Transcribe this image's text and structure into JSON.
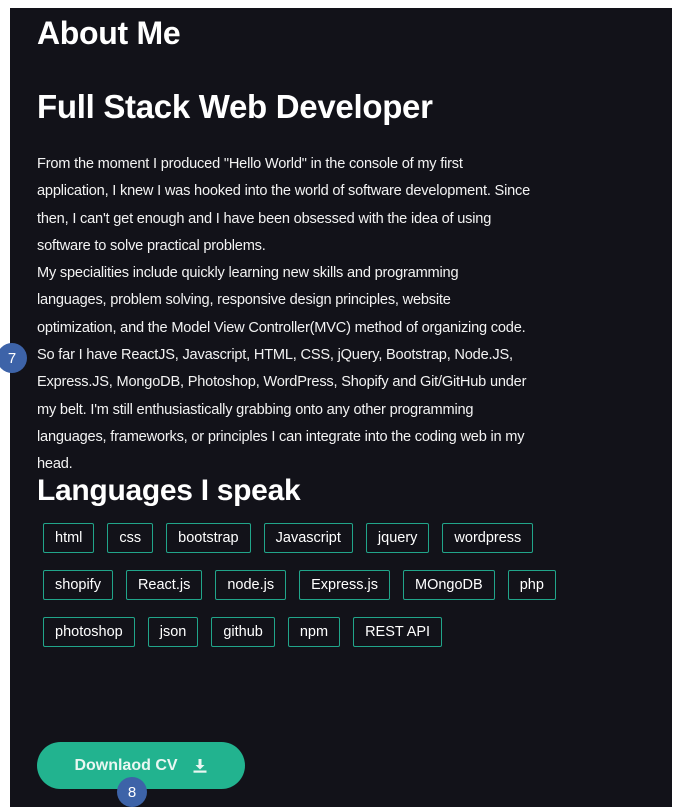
{
  "about": {
    "heading": "About Me"
  },
  "profile": {
    "role": "Full Stack Web Developer",
    "bio_lines": [
      "From the moment I produced \"Hello World\" in the console of my first",
      "application, I knew I was hooked into the world of software development. Since",
      "then, I can't get enough and I have been obsessed with the idea of using",
      "software to solve practical problems.",
      "My specialities include quickly learning new skills and programming",
      "languages, problem solving, responsive design principles, website",
      "optimization, and the Model View Controller(MVC) method of organizing code.",
      "So far I have ReactJS, Javascript, HTML, CSS, jQuery, Bootstrap, Node.JS,",
      "Express.JS, MongoDB, Photoshop, WordPress, Shopify and Git/GitHub under",
      "my belt. I'm still enthusiastically grabbing onto any other programming",
      "languages, frameworks, or principles I can integrate into the coding web in my",
      "head."
    ]
  },
  "languages": {
    "heading": "Languages I speak",
    "tags": [
      "html",
      "css",
      "bootstrap",
      "Javascript",
      "jquery",
      "wordpress",
      "shopify",
      "React.js",
      "node.js",
      "Express.js",
      "MOngoDB",
      "php",
      "photoshop",
      "json",
      "github",
      "npm",
      "REST API"
    ]
  },
  "download": {
    "label": "Downlaod CV",
    "icon": "download-icon"
  },
  "markers": {
    "bio": "7",
    "download": "8"
  },
  "colors": {
    "background": "#121219",
    "accent": "#22b38f",
    "tag_border": "#21a58a",
    "marker": "#3d63a8"
  }
}
